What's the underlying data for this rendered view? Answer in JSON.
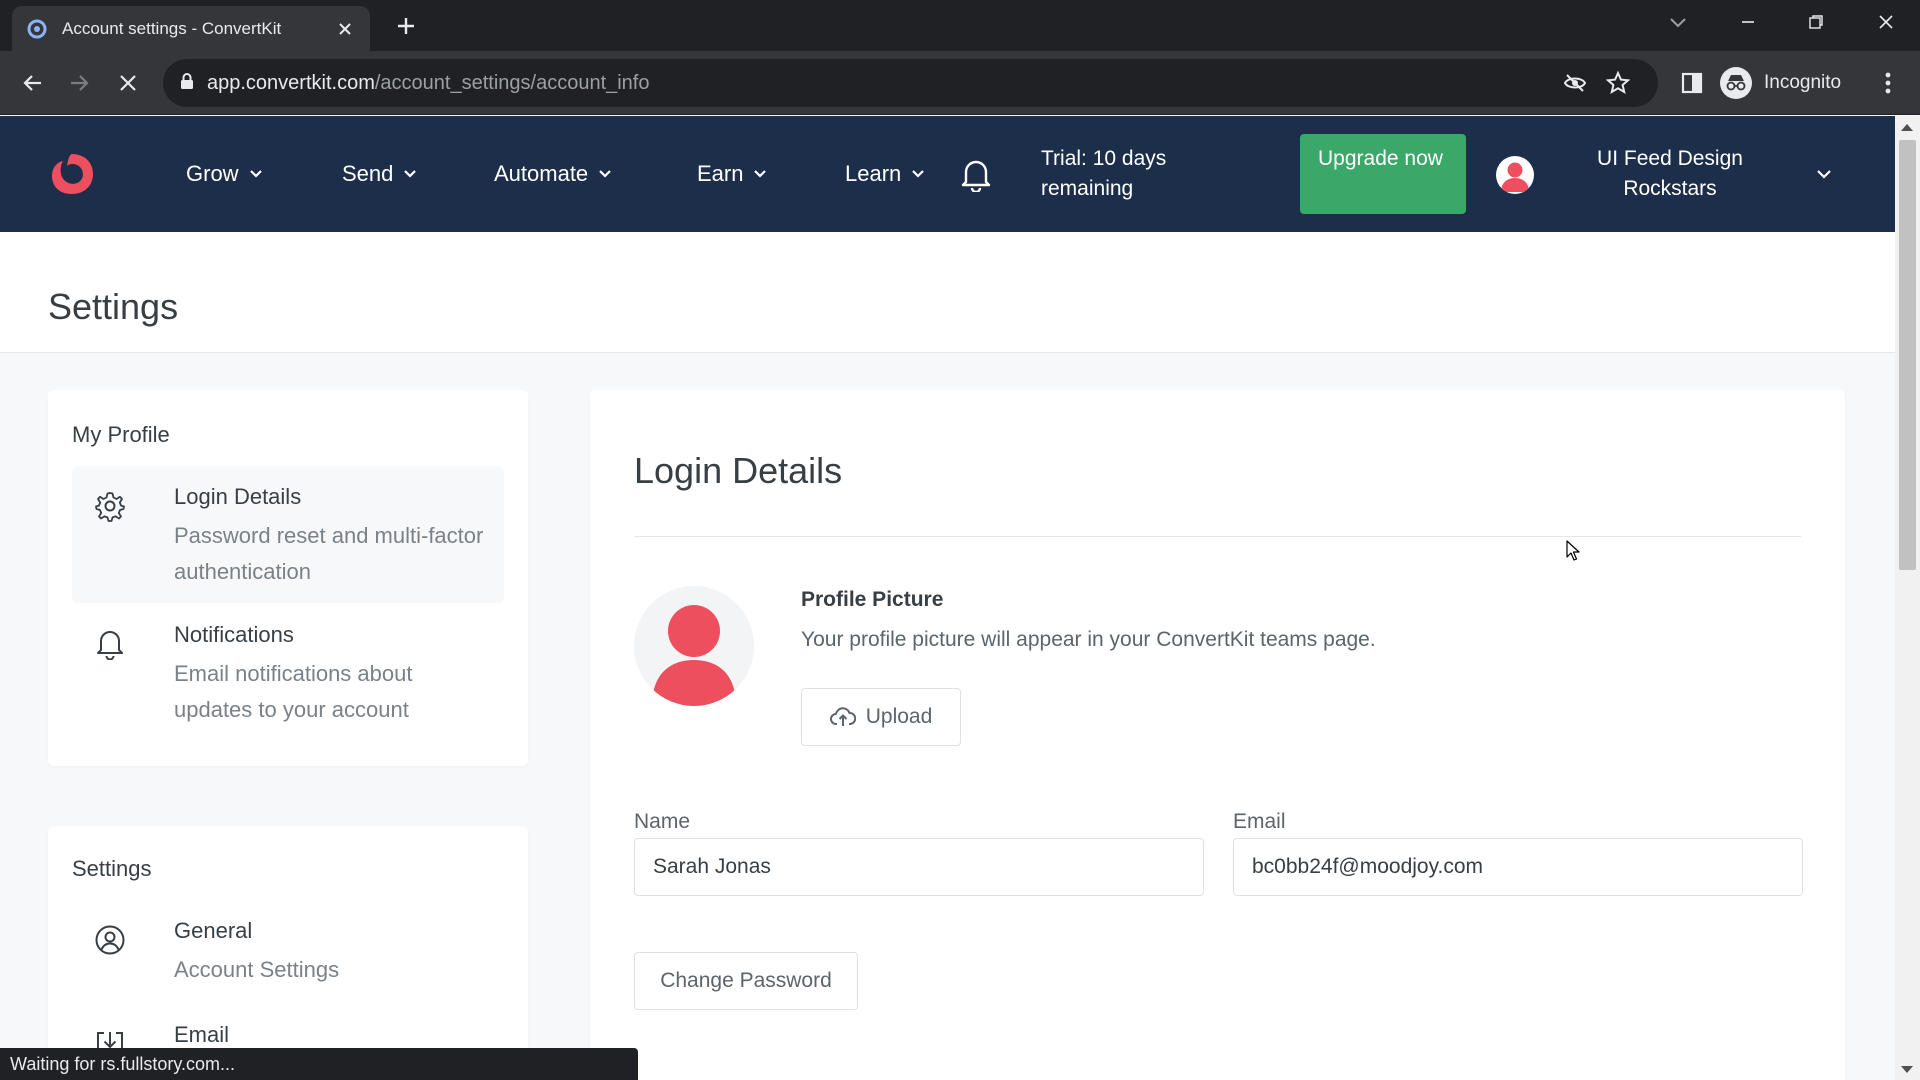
{
  "browser": {
    "tab_title": "Account settings - ConvertKit",
    "url_host": "app.convertkit.com",
    "url_path": "/account_settings/account_info",
    "profile_label": "Incognito",
    "status_text": "Waiting for rs.fullstory.com..."
  },
  "header": {
    "nav": [
      "Grow",
      "Send",
      "Automate",
      "Earn",
      "Learn"
    ],
    "trial_text": "Trial: 10 days remaining",
    "upgrade_label": "Upgrade now",
    "account_name": "UI Feed Design Rockstars"
  },
  "page": {
    "title": "Settings"
  },
  "sidebar": {
    "profile_heading": "My Profile",
    "profile_items": [
      {
        "title": "Login Details",
        "desc": "Password reset and multi-factor authentication",
        "icon": "gear-icon",
        "active": true
      },
      {
        "title": "Notifications",
        "desc": "Email notifications about updates to your account",
        "icon": "bell-icon",
        "active": false
      }
    ],
    "settings_heading": "Settings",
    "settings_items": [
      {
        "title": "General",
        "desc": "Account Settings",
        "icon": "user-circle-icon"
      },
      {
        "title": "Email",
        "desc": "",
        "icon": "inbox-download-icon"
      }
    ]
  },
  "main": {
    "section_title": "Login Details",
    "profile_picture_label": "Profile Picture",
    "profile_picture_desc": "Your profile picture will appear in your ConvertKit teams page.",
    "upload_label": "Upload",
    "name_label": "Name",
    "name_value": "Sarah Jonas",
    "email_label": "Email",
    "email_value": "bc0bb24f@moodjoy.com",
    "change_password_label": "Change Password"
  },
  "colors": {
    "header_bg": "#1d2e4b",
    "upgrade_bg": "#3aa868",
    "brand_accent": "#ee4f5f"
  }
}
